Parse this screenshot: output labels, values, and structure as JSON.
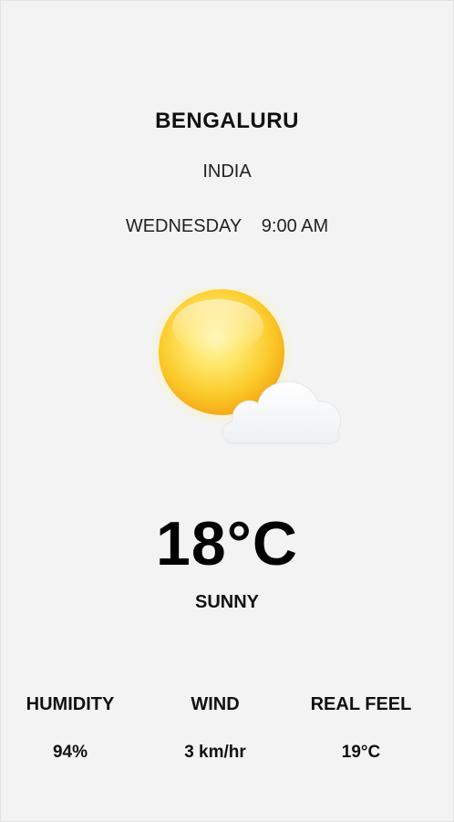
{
  "location": {
    "city": "BENGALURU",
    "country": "INDIA"
  },
  "datetime": {
    "day": "WEDNESDAY",
    "time": "9:00 AM"
  },
  "weather": {
    "icon": "sun-behind-cloud-icon",
    "temperature": "18°C",
    "condition": "SUNNY"
  },
  "stats": {
    "humidity": {
      "label": "HUMIDITY",
      "value": "94%"
    },
    "wind": {
      "label": "WIND",
      "value": "3 km/hr"
    },
    "real_feel": {
      "label": "REAL FEEL",
      "value": "19°C"
    }
  },
  "colors": {
    "background": "#f2f2f2",
    "sun": "#fbd53a",
    "cloud": "#ffffff"
  }
}
